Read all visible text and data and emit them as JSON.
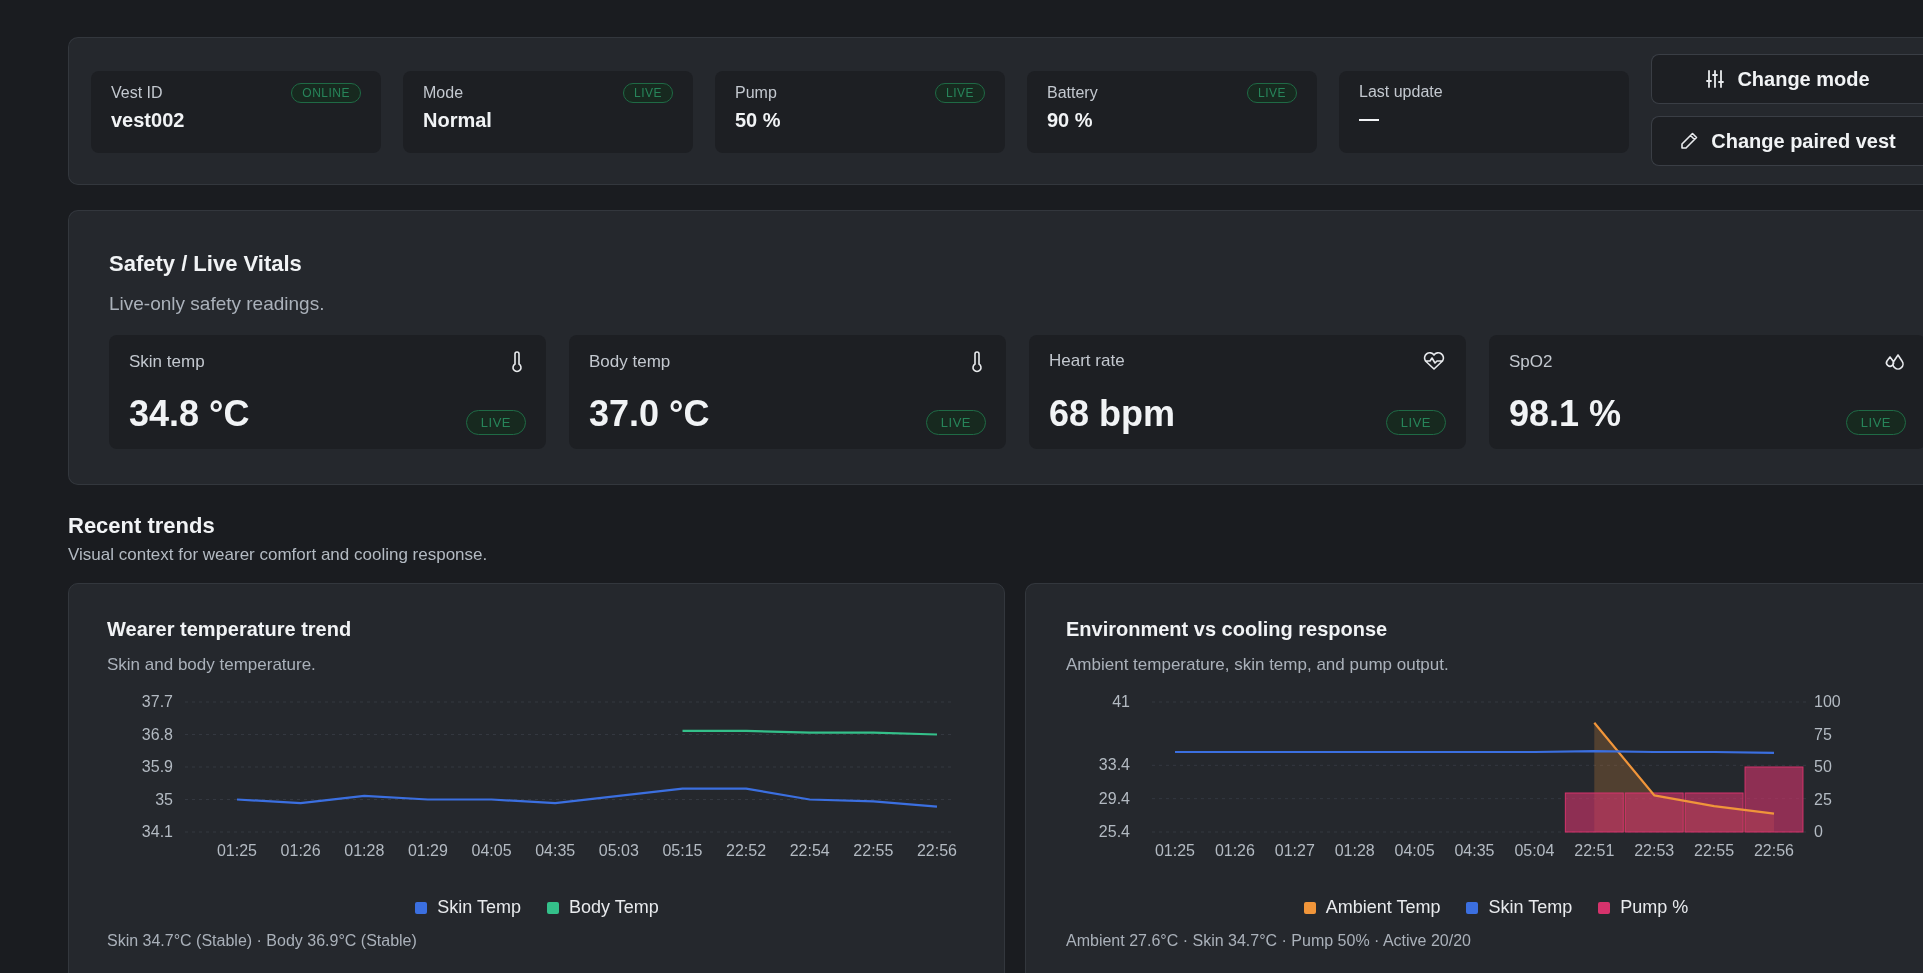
{
  "status_cards": [
    {
      "label": "Vest ID",
      "value": "vest002",
      "badge": "ONLINE"
    },
    {
      "label": "Mode",
      "value": "Normal",
      "badge": "LIVE"
    },
    {
      "label": "Pump",
      "value": "50 %",
      "badge": "LIVE"
    },
    {
      "label": "Battery",
      "value": "90 %",
      "badge": "LIVE"
    },
    {
      "label": "Last update",
      "value": "—"
    }
  ],
  "buttons": [
    {
      "label": "Change mode"
    },
    {
      "label": "Change paired vest"
    }
  ],
  "vitals": {
    "title": "Safety / Live Vitals",
    "subtitle": "Live-only safety readings.",
    "cards": [
      {
        "label": "Skin temp",
        "value": "34.8 °C",
        "badge": "LIVE"
      },
      {
        "label": "Body temp",
        "value": "37.0 °C",
        "badge": "LIVE"
      },
      {
        "label": "Heart rate",
        "value": "68 bpm",
        "badge": "LIVE"
      },
      {
        "label": "SpO2",
        "value": "98.1 %",
        "badge": "LIVE"
      }
    ]
  },
  "trends": {
    "title": "Recent trends",
    "subtitle": "Visual context for wearer comfort and cooling response.",
    "charts": [
      {
        "title": "Wearer temperature trend",
        "subtitle": "Skin and body temperature.",
        "footer": "Skin 34.7°C (Stable) · Body 36.9°C (Stable)",
        "chart_data": {
          "type": "line",
          "categories": [
            "01:25",
            "01:26",
            "01:28",
            "01:29",
            "04:05",
            "04:35",
            "05:03",
            "05:15",
            "22:52",
            "22:54",
            "22:55",
            "22:56"
          ],
          "ylim": [
            34.1,
            37.7
          ],
          "yticks": [
            34.1,
            35,
            35.9,
            36.8,
            37.7
          ],
          "grid": true,
          "series": [
            {
              "name": "Skin Temp",
              "color": "#3b6fe0",
              "values": [
                35.0,
                34.9,
                35.1,
                35.0,
                35.0,
                34.9,
                35.1,
                35.3,
                35.3,
                35.0,
                34.95,
                34.8
              ]
            },
            {
              "name": "Body Temp",
              "color": "#34c08a",
              "values": [
                null,
                null,
                null,
                null,
                null,
                null,
                null,
                36.9,
                36.9,
                36.85,
                36.85,
                36.8
              ]
            }
          ]
        }
      },
      {
        "title": "Environment vs cooling response",
        "subtitle": "Ambient temperature, skin temp, and pump output.",
        "footer": "Ambient 27.6°C · Skin 34.7°C · Pump 50% · Active 20/20",
        "chart_data": {
          "type": "line",
          "categories": [
            "01:25",
            "01:26",
            "01:27",
            "01:28",
            "04:05",
            "04:35",
            "05:04",
            "22:51",
            "22:53",
            "22:55",
            "22:56"
          ],
          "ylim": [
            25.4,
            41
          ],
          "yticks": [
            25.4,
            29.4,
            33.4,
            41
          ],
          "grid": true,
          "y2lim": [
            0,
            100
          ],
          "y2ticks": [
            0,
            25,
            50,
            75,
            100
          ],
          "series": [
            {
              "name": "Ambient Temp",
              "color": "#f0953a",
              "type": "area",
              "values": [
                null,
                null,
                null,
                null,
                null,
                null,
                null,
                38.5,
                29.8,
                28.5,
                27.6
              ]
            },
            {
              "name": "Skin Temp",
              "color": "#3b6fe0",
              "values": [
                35.0,
                35.0,
                35.0,
                35.0,
                35.0,
                35.0,
                35.0,
                35.1,
                35.0,
                35.0,
                34.9
              ]
            },
            {
              "name": "Pump %",
              "color": "#d6336c",
              "type": "bar",
              "axis": "y2",
              "values": [
                null,
                null,
                null,
                null,
                null,
                null,
                null,
                30,
                30,
                30,
                50
              ]
            }
          ]
        }
      }
    ]
  }
}
